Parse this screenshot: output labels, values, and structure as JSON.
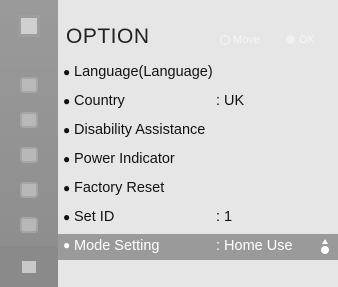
{
  "header": {
    "title": "OPTION",
    "hints": [
      {
        "icon": "move-icon",
        "label": "Move"
      },
      {
        "icon": "ok-icon",
        "label": "OK"
      }
    ]
  },
  "sidebar": {
    "items": [
      {
        "icon": "option-menu-icon"
      },
      {
        "icon": "picture-icon"
      },
      {
        "icon": "audio-icon"
      },
      {
        "icon": "setup-icon"
      },
      {
        "icon": "time-icon"
      },
      {
        "icon": "lock-icon"
      },
      {
        "icon": "option-icon",
        "active": true
      }
    ]
  },
  "menu": {
    "items": [
      {
        "label": "Language(Language)",
        "value": ""
      },
      {
        "label": "Country",
        "value": ": UK"
      },
      {
        "label": "Disability Assistance",
        "value": ""
      },
      {
        "label": "Power Indicator",
        "value": ""
      },
      {
        "label": "Factory Reset",
        "value": ""
      },
      {
        "label": "Set ID",
        "value": ": 1"
      },
      {
        "label": "Mode Setting",
        "value": ": Home Use",
        "selected": true
      }
    ]
  },
  "colors": {
    "background": "#e6e6e6",
    "sidebar": "#8c8c8c",
    "selected_row": "#9a9a9a",
    "text": "#111111",
    "selected_text": "#ffffff"
  }
}
